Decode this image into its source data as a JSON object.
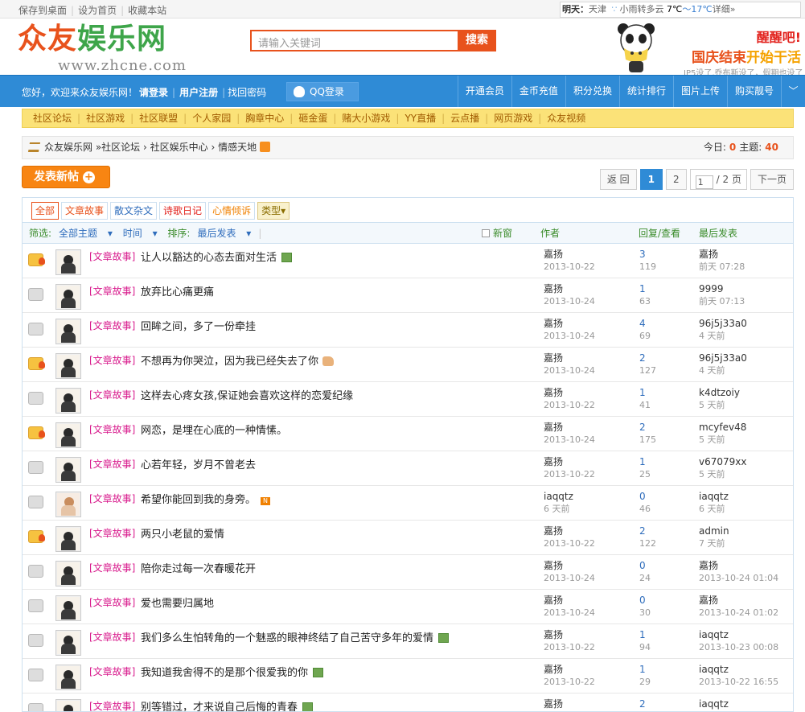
{
  "topbar": {
    "links": [
      "保存到桌面",
      "设为首页",
      "收藏本站"
    ],
    "weather": {
      "label": "明天：",
      "city": "天津",
      "desc": "小雨转多云",
      "low": "7℃",
      "sep": "～",
      "high": "17℃",
      "detail": "详细»"
    }
  },
  "header": {
    "logo_a": "众友",
    "logo_b": "娱乐网",
    "url": "www.zhcne.com",
    "search_placeholder": "请输入关键词",
    "search_button": "搜索",
    "promo1": "醒醒吧!",
    "promo2a": "国庆结束",
    "promo2b": "开始干活",
    "promo3": "IP5没了,乔布斯没了，假期也没了"
  },
  "nav": {
    "welcome": "您好，欢迎来众友娱乐网！",
    "login": "请登录",
    "register": "用户注册",
    "findpw": "找回密码",
    "qq": "QQ登录",
    "right": [
      "开通会员",
      "金币充值",
      "积分兑换",
      "统计排行",
      "图片上传",
      "购买靓号"
    ],
    "arrow": "﹀"
  },
  "subnav": [
    "社区论坛",
    "社区游戏",
    "社区联盟",
    "个人家园",
    "胸章中心",
    "砸金蛋",
    "赌大小游戏",
    "YY直播",
    "云点播",
    "网页游戏",
    "众友视频"
  ],
  "crumb": {
    "items": [
      "众友娱乐网",
      "»社区论坛",
      "›",
      "社区娱乐中心",
      "›",
      "情感天地"
    ],
    "today_label": "今日:",
    "today": "0",
    "topics_label": "主题:",
    "topics": "40"
  },
  "post_button": "发表新帖",
  "post_plus": "+",
  "pager": {
    "back": "返 回",
    "p1": "1",
    "p2": "2",
    "input": "1",
    "total": "/ 2 页",
    "next": "下一页"
  },
  "types": [
    "全部",
    "文章故事",
    "散文杂文",
    "诗歌日记",
    "心情倾诉",
    "类型▾"
  ],
  "filter": {
    "label": "筛选:",
    "all": "全部主题",
    "time": "时间",
    "sort": "排序:",
    "last": "最后发表",
    "newwin": "新窗",
    "author": "作者",
    "reply": "回复/查看",
    "lastpost": "最后发表"
  },
  "threads": [
    {
      "hot": true,
      "girl": false,
      "tag": "[文章故事]",
      "title": "让人以豁达的心态去面对生活",
      "mark": "att",
      "author": "嘉扬",
      "date": "2013-10-22",
      "replies": "3",
      "views": "119",
      "last": "嘉扬",
      "lastdate": "前天 07:28"
    },
    {
      "hot": false,
      "girl": false,
      "tag": "[文章故事]",
      "title": "放弃比心痛更痛",
      "mark": "",
      "author": "嘉扬",
      "date": "2013-10-24",
      "replies": "1",
      "views": "63",
      "last": "9999",
      "lastdate": "前天 07:13"
    },
    {
      "hot": false,
      "girl": false,
      "tag": "[文章故事]",
      "title": "回眸之间，多了一份牵挂",
      "mark": "",
      "author": "嘉扬",
      "date": "2013-10-24",
      "replies": "4",
      "views": "69",
      "last": "96j5j33a0",
      "lastdate": "4 天前"
    },
    {
      "hot": true,
      "girl": false,
      "tag": "[文章故事]",
      "title": "不想再为你哭泣，因为我已经失去了你",
      "mark": "hand",
      "author": "嘉扬",
      "date": "2013-10-24",
      "replies": "2",
      "views": "127",
      "last": "96j5j33a0",
      "lastdate": "4 天前"
    },
    {
      "hot": false,
      "girl": false,
      "tag": "[文章故事]",
      "title": "这样去心疼女孩,保证她会喜欢这样的恋爱纪缘",
      "mark": "",
      "author": "嘉扬",
      "date": "2013-10-22",
      "replies": "1",
      "views": "41",
      "last": "k4dtzoiy",
      "lastdate": "5 天前"
    },
    {
      "hot": true,
      "girl": false,
      "tag": "[文章故事]",
      "title": "网恋，是埋在心底的一种情愫。",
      "mark": "",
      "author": "嘉扬",
      "date": "2013-10-24",
      "replies": "2",
      "views": "175",
      "last": "mcyfev48",
      "lastdate": "5 天前"
    },
    {
      "hot": false,
      "girl": false,
      "tag": "[文章故事]",
      "title": "心若年轻，岁月不曾老去",
      "mark": "",
      "author": "嘉扬",
      "date": "2013-10-22",
      "replies": "1",
      "views": "25",
      "last": "v67079xx",
      "lastdate": "5 天前"
    },
    {
      "hot": false,
      "girl": true,
      "tag": "[文章故事]",
      "title": "希望你能回到我的身旁。",
      "mark": "new",
      "author": "iaqqtz",
      "date": "6 天前",
      "replies": "0",
      "views": "46",
      "last": "iaqqtz",
      "lastdate": "6 天前"
    },
    {
      "hot": true,
      "girl": false,
      "tag": "[文章故事]",
      "title": "两只小老鼠的爱情",
      "mark": "",
      "author": "嘉扬",
      "date": "2013-10-22",
      "replies": "2",
      "views": "122",
      "last": "admin",
      "lastdate": "7 天前"
    },
    {
      "hot": false,
      "girl": false,
      "tag": "[文章故事]",
      "title": "陪你走过每一次春暖花开",
      "mark": "",
      "author": "嘉扬",
      "date": "2013-10-24",
      "replies": "0",
      "views": "24",
      "last": "嘉扬",
      "lastdate": "2013-10-24 01:04"
    },
    {
      "hot": false,
      "girl": false,
      "tag": "[文章故事]",
      "title": "爱也需要归属地",
      "mark": "",
      "author": "嘉扬",
      "date": "2013-10-24",
      "replies": "0",
      "views": "30",
      "last": "嘉扬",
      "lastdate": "2013-10-24 01:02"
    },
    {
      "hot": false,
      "girl": false,
      "tag": "[文章故事]",
      "title": "我们多么生怕转角的一个魅惑的眼神终结了自己苦守多年的爱情",
      "mark": "att",
      "author": "嘉扬",
      "date": "2013-10-22",
      "replies": "1",
      "views": "94",
      "last": "iaqqtz",
      "lastdate": "2013-10-23 00:08"
    },
    {
      "hot": false,
      "girl": false,
      "tag": "[文章故事]",
      "title": "我知道我舍得不的是那个很爱我的你",
      "mark": "att",
      "author": "嘉扬",
      "date": "2013-10-22",
      "replies": "1",
      "views": "29",
      "last": "iaqqtz",
      "lastdate": "2013-10-22 16:55"
    },
    {
      "hot": false,
      "girl": false,
      "tag": "[文章故事]",
      "title": "别等错过，才来说自己后悔的青春",
      "mark": "att",
      "author": "嘉扬",
      "date": "2013-10-22",
      "replies": "2",
      "views": "",
      "last": "iaqqtz",
      "lastdate": ""
    }
  ]
}
